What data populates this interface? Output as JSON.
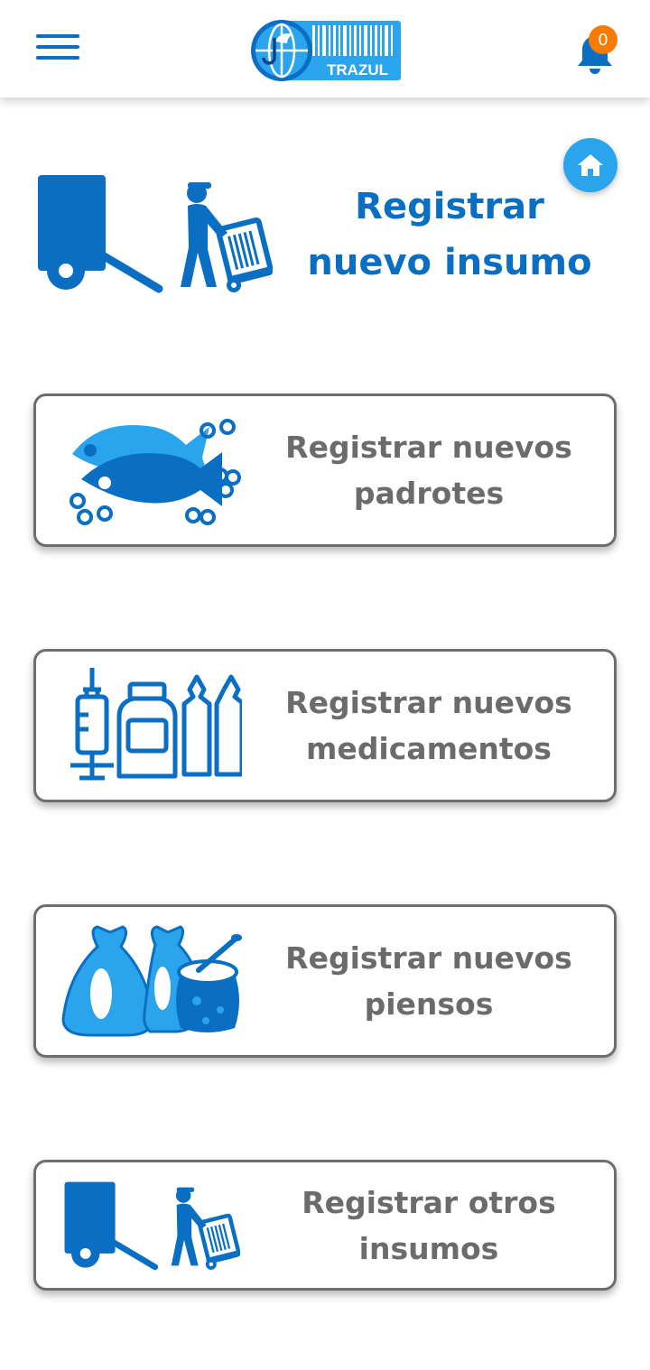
{
  "header": {
    "menu_icon": "hamburger-menu-icon",
    "logo_text": "TRAZUL",
    "notification_icon": "bell-icon",
    "notification_count": "0",
    "accent_color": "#0a6fc2",
    "badge_color": "#f57c00"
  },
  "home_button": {
    "icon": "home-icon",
    "color": "#2aa4ec"
  },
  "hero": {
    "icon": "delivery-truck-worker-icon",
    "title": "Registrar nuevo insumo"
  },
  "cards": [
    {
      "label": "Registrar nuevos padrotes",
      "icon": "fish-icon"
    },
    {
      "label": "Registrar nuevos medicamentos",
      "icon": "medicine-icon"
    },
    {
      "label": "Registrar nuevos piensos",
      "icon": "feed-sack-icon"
    },
    {
      "label": "Registrar otros insumos",
      "icon": "delivery-truck-worker-icon"
    }
  ]
}
